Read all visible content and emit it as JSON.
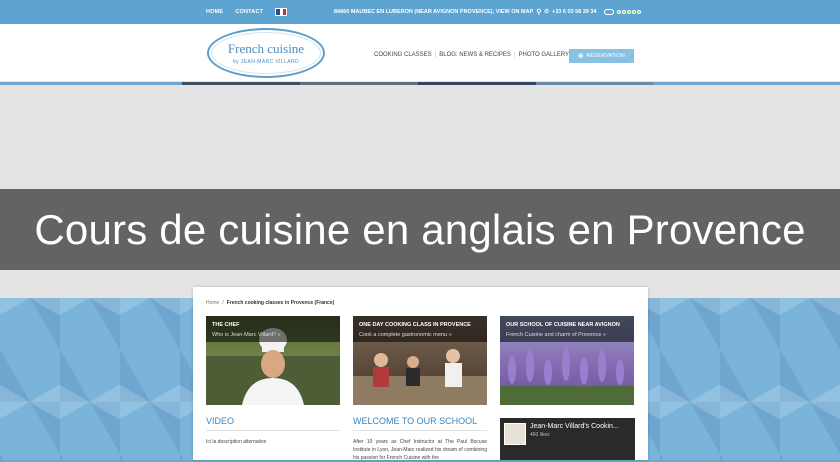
{
  "topbar": {
    "nav": [
      "HOME",
      "CONTACT"
    ],
    "address": "84660 MAUBEC EN LUBERON (NEAR AVIGNON PROVENCE), VIEW ON MAP",
    "phone": "+33 6 03 58 39 34"
  },
  "header": {
    "logo_line1": "French cuisine",
    "logo_line2": "by JEAN-MARC VILLARD",
    "nav": [
      "COOKING CLASSES",
      "BLOG: NEWS & RECIPES",
      "PHOTO GALLERY"
    ],
    "reservation": "RESERVATION"
  },
  "banner": {
    "title": "Cours de cuisine en anglais en Provence"
  },
  "content": {
    "breadcrumb_home": "Home",
    "breadcrumb_current": "French cooking classes in Provence (France)",
    "tiles": [
      {
        "title": "THE CHEF",
        "subtitle": "Who is Jean-Marc Villard? »"
      },
      {
        "title": "ONE DAY COOKING CLASS IN PROVENCE",
        "subtitle": "Cook a complete gastronomic menu »"
      },
      {
        "title": "OUR SCHOOL OF CUISINE NEAR AVIGNON",
        "subtitle": "French Cuisine and charm of Provence »"
      }
    ],
    "video_heading": "VIDEO",
    "video_text": "Ici la description alternative",
    "welcome_heading": "WELCOME TO OUR SCHOOL",
    "welcome_text": "After 10 years as Chef Instructor at The Paul Bocuse Institute in Lyon, Jean-Marc realized his dream of combining his passion for French Cuisine with the",
    "fb_name": "Jean-Marc Villard's Cookin...",
    "fb_count": "460 likes"
  },
  "colors": {
    "topbar": "#5da4d0",
    "accent": "#3d84bb",
    "banner": "#636363"
  }
}
